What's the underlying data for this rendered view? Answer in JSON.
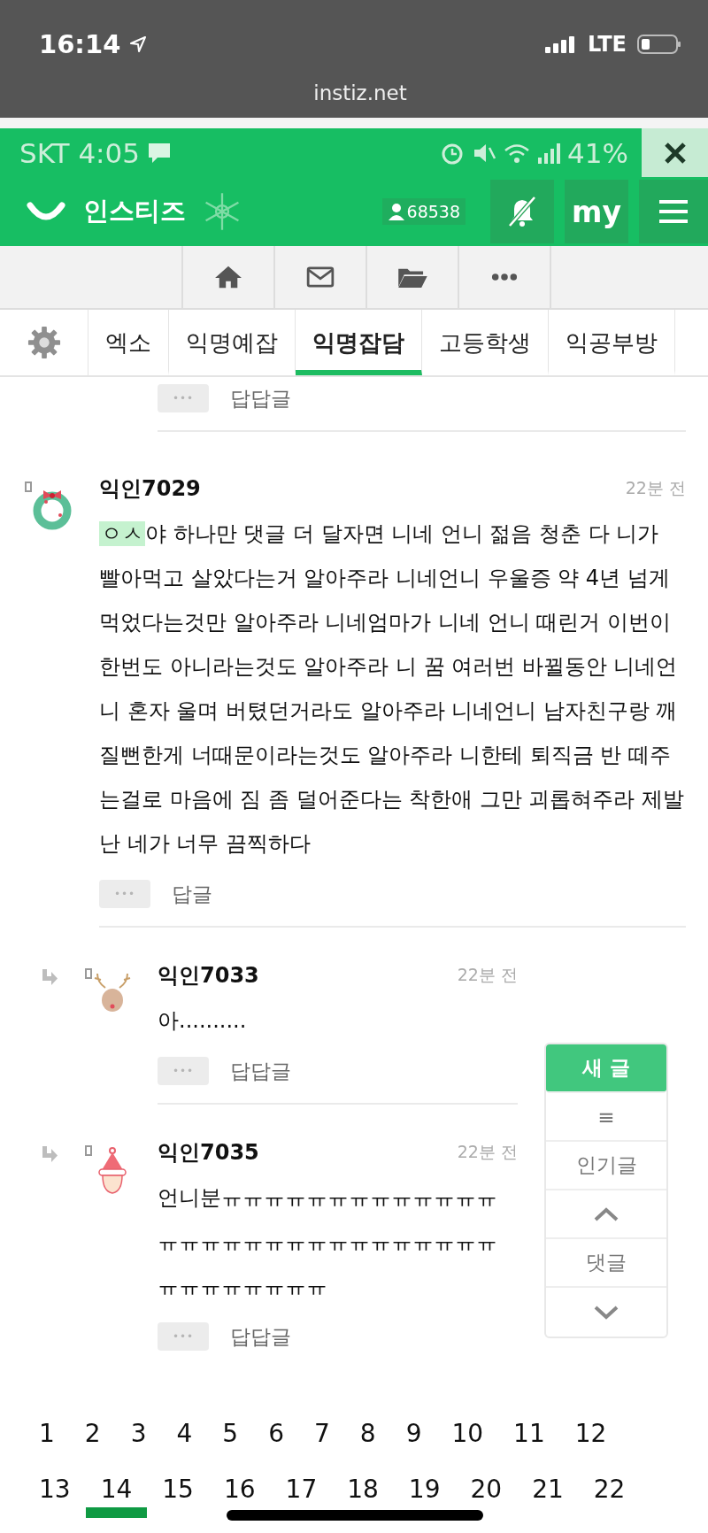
{
  "phone_status": {
    "time": "16:14",
    "network": "LTE",
    "url": "instiz.net"
  },
  "inner_status": {
    "carrier_time": "SKT 4:05",
    "battery": "41%"
  },
  "header": {
    "logo": "인스티즈",
    "user_count": "68538",
    "my": "my"
  },
  "tabs": [
    {
      "label": "엑소",
      "selected": false
    },
    {
      "label": "익명예잡",
      "selected": false
    },
    {
      "label": "익명잡담",
      "selected": true
    },
    {
      "label": "고등학생",
      "selected": false
    },
    {
      "label": "익공부방",
      "selected": false
    }
  ],
  "previous_action": {
    "more": "•••",
    "label": "답답글"
  },
  "comments": [
    {
      "is_reply": false,
      "avatar": {
        "kind": "wreath"
      },
      "name": "익인7029",
      "time": "22분 전",
      "highlight": "ㅇㅅ",
      "text": "야 하나만 댓글 더 달자면 니네 언니 젊음 청춘 다 니가 빨아먹고 살았다는거 알아주라 니네언니 우울증 약 4년 넘게 먹었다는것만 알아주라 니네엄마가 니네 언니 때린거 이번이 한번도 아니라는것도 알아주라 니 꿈 여러번 바뀔동안 니네언니 혼자 울며 버텼던거라도 알아주라 니네언니 남자친구랑 깨질뻔한게 너때문이라는것도 알아주라 니한테 퇴직금 반 떼주는걸로 마음에 짐 좀 덜어준다는 착한애 그만 괴롭혀주라 제발 난 네가 너무 끔찍하다",
      "more": "•••",
      "action": "답글"
    },
    {
      "is_reply": true,
      "avatar": {
        "kind": "reindeer"
      },
      "name": "익인7033",
      "time": "22분 전",
      "text": "아..........",
      "more": "•••",
      "action": "답답글"
    },
    {
      "is_reply": true,
      "avatar": {
        "kind": "santa"
      },
      "name": "익인7035",
      "time": "22분 전",
      "text": "언니분ㅠㅠㅠㅠㅠㅠㅠㅠㅠㅠㅠㅠㅠㅠㅠㅠㅠㅠㅠㅠㅠㅠㅠㅠㅠㅠㅠㅠㅠㅠㅠㅠㅠㅠㅠㅠㅠ",
      "more": "•••",
      "action": "답답글"
    }
  ],
  "float_menu": [
    {
      "kind": "new",
      "label": "새 글"
    },
    {
      "kind": "list",
      "label": "≡"
    },
    {
      "kind": "text",
      "label": "인기글"
    },
    {
      "kind": "up"
    },
    {
      "kind": "text",
      "label": "댓글"
    },
    {
      "kind": "down"
    }
  ],
  "pages": [
    {
      "label": "1",
      "selected": false
    },
    {
      "label": "2",
      "selected": false
    },
    {
      "label": "3",
      "selected": false
    },
    {
      "label": "4",
      "selected": false
    },
    {
      "label": "5",
      "selected": false
    },
    {
      "label": "6",
      "selected": false
    },
    {
      "label": "7",
      "selected": false
    },
    {
      "label": "8",
      "selected": false
    },
    {
      "label": "9",
      "selected": false
    },
    {
      "label": "10",
      "selected": false
    },
    {
      "label": "11",
      "selected": false
    },
    {
      "label": "12",
      "selected": false
    },
    {
      "label": "13",
      "selected": false
    },
    {
      "label": "14",
      "selected": true
    },
    {
      "label": "15",
      "selected": false
    },
    {
      "label": "16",
      "selected": false
    },
    {
      "label": "17",
      "selected": false
    },
    {
      "label": "18",
      "selected": false
    },
    {
      "label": "19",
      "selected": false
    },
    {
      "label": "20",
      "selected": false
    },
    {
      "label": "21",
      "selected": false
    },
    {
      "label": "22",
      "selected": false
    }
  ]
}
